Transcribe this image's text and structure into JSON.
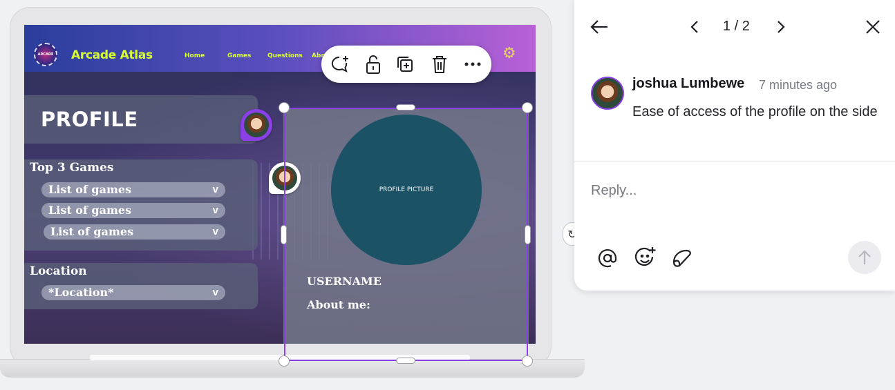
{
  "website": {
    "site_name": "Arcade Atlas",
    "logo_text": "ARCADE",
    "nav": [
      "Home",
      "Games",
      "Questions",
      "Abo"
    ],
    "profile_title": "PROFILE",
    "top_games_title": "Top 3 Games",
    "games": [
      "List of games",
      "List of games",
      "List of games"
    ],
    "dropdown_chevron": "v",
    "location_title": "Location",
    "location_value": "*Location*",
    "profile_picture_label": "PROFILE PICTURE",
    "username_label": "USERNAME",
    "about_label": "About me:"
  },
  "toolbar": {
    "buttons": [
      "add-comment-icon",
      "unlock-icon",
      "duplicate-icon",
      "trash-icon",
      "more-icon"
    ]
  },
  "comment_panel": {
    "pager": "1 / 2",
    "author": "joshua Lumbewe",
    "time": "7 minutes ago",
    "body": "Ease of access of the profile on the side",
    "reply_placeholder": "Reply..."
  },
  "colors": {
    "selection": "#8b3fe6",
    "site_accent": "#d8ff2e",
    "profile_circle": "#1c5266"
  }
}
